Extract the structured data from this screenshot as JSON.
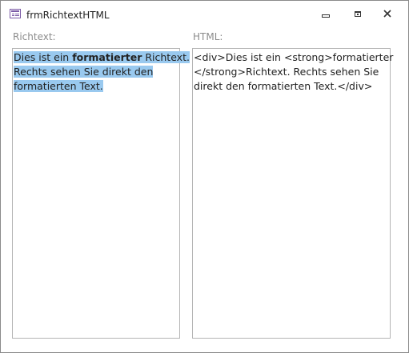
{
  "window": {
    "title": "frmRichtextHTML"
  },
  "form": {
    "richtext_label": "Richtext:",
    "html_label": "HTML:",
    "richtext": {
      "line1_pre": "Dies ist ein ",
      "line1_bold": "formatierter",
      "line1_post": " Richtext.",
      "line2": "Rechts sehen Sie direkt den",
      "line3": "formatierten Text."
    },
    "html": {
      "line1": "<div>Dies ist ein <strong>formatierter",
      "line2": "</strong>Richtext. Rechts sehen Sie",
      "line3": "direkt den formatierten Text.</div>"
    }
  },
  "colors": {
    "selection": "#99c9ef",
    "label_gray": "#8c8c8c",
    "border": "#b4b4b4"
  },
  "icons": [
    "form-icon",
    "minimize-icon",
    "maximize-icon",
    "close-icon"
  ]
}
